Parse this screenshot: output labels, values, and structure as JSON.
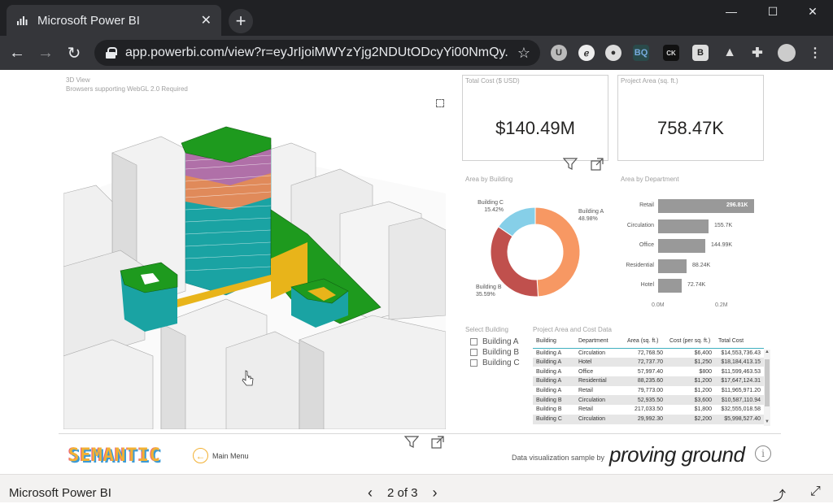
{
  "browser": {
    "tab_title": "Microsoft Power BI",
    "tab_close": "✕",
    "new_tab": "+",
    "url": "app.powerbi.com/view?r=eyJrIjoiMWYzYjg2NDUtODcyYi00NmQy...",
    "window_controls": [
      "—",
      "☐",
      "✕"
    ]
  },
  "report": {
    "view3d": {
      "title": "3D View",
      "subtitle": "Browsers supporting WebGL 2.0 Required"
    },
    "card_cost": {
      "label": "Total Cost ($ USD)",
      "value": "$140.49M"
    },
    "card_area": {
      "label": "Project Area (sq. ft.)",
      "value": "758.47K"
    },
    "donut": {
      "label": "Area by Building",
      "slices": [
        {
          "name": "Building A",
          "pct": "48.98%",
          "value": 48.98,
          "color": "#f79863"
        },
        {
          "name": "Building B",
          "pct": "35.59%",
          "value": 35.59,
          "color": "#c0504d"
        },
        {
          "name": "Building C",
          "pct": "15.42%",
          "value": 15.42,
          "color": "#86cfe8"
        }
      ]
    },
    "bars": {
      "label": "Area by Department",
      "items": [
        {
          "cat": "Retail",
          "val": "296.81K",
          "v": 296.81
        },
        {
          "cat": "Circulation",
          "val": "155.7K",
          "v": 155.7
        },
        {
          "cat": "Office",
          "val": "144.99K",
          "v": 144.99
        },
        {
          "cat": "Residential",
          "val": "88.24K",
          "v": 88.24
        },
        {
          "cat": "Hotel",
          "val": "72.74K",
          "v": 72.74
        }
      ],
      "axis": [
        "0.0M",
        "0.2M"
      ],
      "color": "#999999"
    },
    "slicer": {
      "label": "Select Building",
      "items": [
        "Building A",
        "Building B",
        "Building C"
      ]
    },
    "table": {
      "label": "Project Area and Cost Data",
      "headers": [
        "Building",
        "Department",
        "Area (sq. ft.)",
        "Cost (per sq. ft.)",
        "Total Cost"
      ],
      "rows": [
        [
          "Building A",
          "Circulation",
          "72,768.50",
          "$6,400",
          "$14,553,736.43"
        ],
        [
          "Building A",
          "Hotel",
          "72,737.70",
          "$1,250",
          "$18,184,413.15"
        ],
        [
          "Building A",
          "Office",
          "57,997.40",
          "$800",
          "$11,599,463.53"
        ],
        [
          "Building A",
          "Residential",
          "88,235.60",
          "$1,200",
          "$17,647,124.31"
        ],
        [
          "Building A",
          "Retail",
          "79,773.00",
          "$1,200",
          "$11,965,971.20"
        ],
        [
          "Building B",
          "Circulation",
          "52,935.50",
          "$3,600",
          "$10,587,110.94"
        ],
        [
          "Building B",
          "Retail",
          "217,033.50",
          "$1,800",
          "$32,555,018.58"
        ],
        [
          "Building C",
          "Circulation",
          "29,992.30",
          "$2,200",
          "$5,998,527.40"
        ]
      ]
    },
    "footer": {
      "logo": "SEMANTIC",
      "main_menu": "Main Menu",
      "credit": "Data visualization sample by",
      "pg_logo": "proving ground",
      "info": "i"
    }
  },
  "bottombar": {
    "app_name": "Microsoft Power BI",
    "page": "2 of 3"
  },
  "colors": {
    "green": "#1e9a1e",
    "teal": "#1aa3a3",
    "orange": "#e08a5a",
    "purple": "#b070a8",
    "yellow": "#e8b41a"
  }
}
